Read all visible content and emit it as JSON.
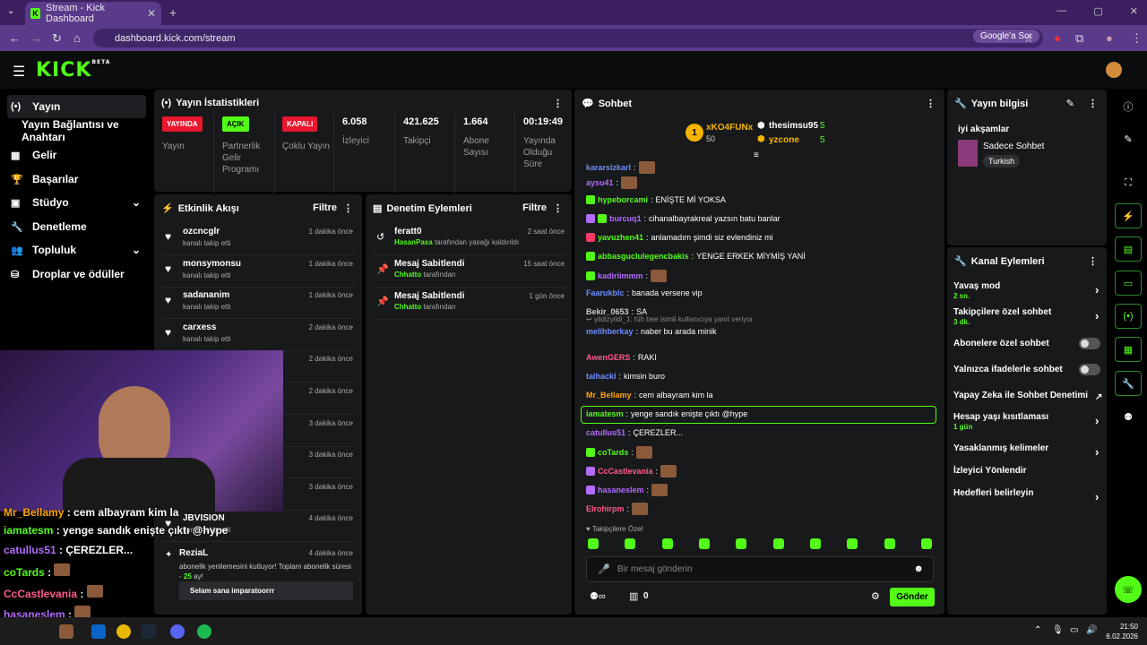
{
  "browser": {
    "tab_title": "Stream - Kick Dashboard",
    "tab_close": "✕",
    "new_tab": "+",
    "url": "dashboard.kick.com/stream",
    "google_button": "Google'a Sor"
  },
  "topnav": {
    "logo": "KICK",
    "logo_beta": "BETA"
  },
  "sidebar": {
    "items": [
      {
        "label": "Yayın",
        "icon": "(•)"
      },
      {
        "label": "Yayın Bağlantısı ve Anahtarı",
        "icon": ""
      },
      {
        "label": "Gelir",
        "icon": "▦"
      },
      {
        "label": "Başarılar",
        "icon": "🏆"
      },
      {
        "label": "Stüdyo",
        "icon": "▣"
      },
      {
        "label": "Denetleme",
        "icon": "🔧"
      },
      {
        "label": "Topluluk",
        "icon": "👥"
      },
      {
        "label": "Droplar ve ödüller",
        "icon": "⛁"
      }
    ]
  },
  "stats": {
    "title": "Yayın İstatistikleri",
    "status": {
      "badge": "YAYINDA",
      "label": "Yayın"
    },
    "partner": {
      "badge": "AÇIK",
      "label": "Partnerlik Gelir Programı"
    },
    "multi": {
      "badge": "KAPALI",
      "label": "Çoklu Yayın"
    },
    "viewers": {
      "value": "6.058",
      "label": "İzleyici"
    },
    "followers": {
      "value": "421.625",
      "label": "Takipçi"
    },
    "subs": {
      "value": "1.664",
      "label": "Abone Sayısı"
    },
    "uptime": {
      "value": "00:19:49",
      "label": "Yayında Olduğu Süre"
    }
  },
  "activity": {
    "title": "Etkinlik Akışı",
    "filter": "Filtre",
    "rows": [
      {
        "name": "ozcncglr",
        "sub": "kanalı takip etti",
        "time": "1 dakika önce"
      },
      {
        "name": "monsymonsu",
        "sub": "kanalı takip etti",
        "time": "1 dakika önce"
      },
      {
        "name": "sadananim",
        "sub": "kanalı takip etti",
        "time": "1 dakika önce"
      },
      {
        "name": "carxess",
        "sub": "kanalı takip etti",
        "time": "2 dakika önce"
      },
      {
        "name": "",
        "sub": "",
        "time": "2 dakika önce"
      },
      {
        "name": "",
        "sub": "",
        "time": "2 dakika önce"
      },
      {
        "name": "",
        "sub": "",
        "time": "3 dakika önce"
      },
      {
        "name": "",
        "sub": "",
        "time": "3 dakika önce"
      },
      {
        "name": "",
        "sub": "",
        "time": "3 dakika önce"
      },
      {
        "name": "JBVISION",
        "sub": "kanalı takip etti",
        "time": "4 dakika önce"
      }
    ],
    "sub_event": {
      "name": "ReziaL",
      "time": "4 dakika önce",
      "text": "abonelik yenilemesini kutluyor! Toplam abonelik süresi -",
      "months": "25",
      "months_suffix": "ay!",
      "message": "Selam sana imparatoorrr"
    }
  },
  "moderation": {
    "title": "Denetim Eylemleri",
    "filter": "Filtre",
    "rows": [
      {
        "name": "feratt0",
        "mod": "HasanPasa",
        "sub": "tarafından yasağı kaldırıldı",
        "time": "2 saat önce",
        "icon": "↺"
      },
      {
        "name": "Mesaj Sabitlendi",
        "mod": "Chhatto",
        "sub": "tarafından",
        "time": "15 saat önce",
        "icon": "📌"
      },
      {
        "name": "Mesaj Sabitlendi",
        "mod": "Chhatto",
        "sub": "tarafından",
        "time": "1 gün önce",
        "icon": "📌"
      }
    ]
  },
  "chat": {
    "title": "Sohbet",
    "leaders": [
      {
        "name": "xKO4FUNx",
        "value": "50",
        "rank": "1"
      },
      {
        "name": "thesimsu95",
        "value": "5"
      },
      {
        "name": "yzcone",
        "value": "5"
      }
    ],
    "messages": [
      {
        "user": "kararsizkarl",
        "color": "#6b8cff",
        "text": "",
        "emote": true
      },
      {
        "user": "aysu41",
        "color": "#b36cff",
        "text": "",
        "emote": true
      },
      {
        "user": "hypeborcami",
        "color": "#53fc18",
        "text": "ENİŞTE Mİ YOKSA",
        "badge": "k"
      },
      {
        "user": "burcuq1",
        "color": "#b36cff",
        "text": "cihanalbayrakreal yazsın batu banlar",
        "badge": "pk"
      },
      {
        "user": "yavuzhen41",
        "color": "#53fc18",
        "text": "anlamadım şimdi siz evlendiniz mi",
        "badge": "r"
      },
      {
        "user": "abbasguclulegencbakis",
        "color": "#53fc18",
        "text": "YENGE ERKEK MİYMİŞ YANİ",
        "badge": "k"
      },
      {
        "user": "kadiriimmm",
        "color": "#b36cff",
        "text": "",
        "emote": true,
        "badge": "k"
      },
      {
        "user": "Faarukblc",
        "color": "#6b8cff",
        "text": "banada versene vip"
      },
      {
        "user": "Bekir_0653",
        "color": "#cccccc",
        "text": "SA"
      },
      {
        "user": "melihberkay",
        "color": "#6b8cff",
        "text": "naber bu arada minik",
        "reply": "yildizyildi_1: tüh bee isimli kullanıcıya yanıt veriyor"
      },
      {
        "user": "AwenGERS",
        "color": "#ff5a8a",
        "text": "RAKI"
      },
      {
        "user": "talhackl",
        "color": "#6b8cff",
        "text": "kimsin buro"
      },
      {
        "user": "Mr_Bellamy",
        "color": "#ffa500",
        "text": "cem albayram kim la"
      },
      {
        "user": "iamatesm",
        "color": "#53fc18",
        "text": "yenge sandık enişte çıktı @hype"
      },
      {
        "user": "catullus51",
        "color": "#b36cff",
        "text": "ÇEREZLER..."
      },
      {
        "user": "coTards",
        "color": "#53fc18",
        "text": "",
        "emote": true,
        "badge": "k"
      },
      {
        "user": "CcCastlevania",
        "color": "#ff5a8a",
        "text": "",
        "emote": true,
        "badge": "p"
      },
      {
        "user": "hasaneslem",
        "color": "#b36cff",
        "text": "",
        "emote": true,
        "badge": "p"
      },
      {
        "user": "Elrohirpm",
        "color": "#ff5a8a",
        "text": "",
        "emote": true
      }
    ],
    "followers_only": "Takipçilere Özel",
    "placeholder": "Bir mesaj gönderin",
    "points": "0",
    "send": "Gönder"
  },
  "stream_info": {
    "title": "Yayın bilgisi",
    "stream_title": "iyi akşamlar",
    "category": "Sadece Sohbet",
    "language": "Turkish"
  },
  "channel_actions": {
    "title": "Kanal Eylemleri",
    "items": [
      {
        "label": "Yavaş mod",
        "sub": "2 sn.",
        "type": "arrow"
      },
      {
        "label": "Takipçilere özel sohbet",
        "sub": "3 dk.",
        "type": "arrow"
      },
      {
        "label": "Abonelere özel sohbet",
        "sub": "",
        "type": "toggle"
      },
      {
        "label": "Yalnızca ifadelerle sohbet",
        "sub": "",
        "type": "toggle"
      },
      {
        "label": "Yapay Zeka ile Sohbet Denetimi",
        "sub": "",
        "type": "external"
      },
      {
        "label": "Hesap yaşı kısıtlaması",
        "sub": "1 gün",
        "type": "arrow"
      },
      {
        "label": "Yasaklanmış kelimeler",
        "sub": "",
        "type": "arrow"
      },
      {
        "label": "İzleyici Yönlendir",
        "sub": "",
        "type": "none"
      },
      {
        "label": "Hedefleri belirleyin",
        "sub": "",
        "type": "arrow"
      }
    ]
  },
  "overlay_chat": [
    {
      "user": "Mr_Bellamy",
      "text": "cem albayram kim la",
      "color": "#ffa500"
    },
    {
      "user": "iamatesm",
      "text": "yenge sandık enişte çıktı @hype",
      "color": "#53fc18"
    },
    {
      "user": "catullus51",
      "text": "ÇEREZLER...",
      "color": "#b36cff"
    },
    {
      "user": "coTards",
      "text": "",
      "color": "#53fc18"
    },
    {
      "user": "CcCastlevania",
      "text": "",
      "color": "#ff5a8a"
    },
    {
      "user": "hasaneslem",
      "text": "",
      "color": "#b36cff"
    },
    {
      "user": "Elrohirpm",
      "text": "",
      "color": "#ff5a8a"
    }
  ],
  "taskbar": {
    "time": "21:50",
    "date": "6.02.2026"
  },
  "colors": {
    "accent": "#53fc18",
    "panel": "#18191b",
    "live": "#e8172c"
  }
}
